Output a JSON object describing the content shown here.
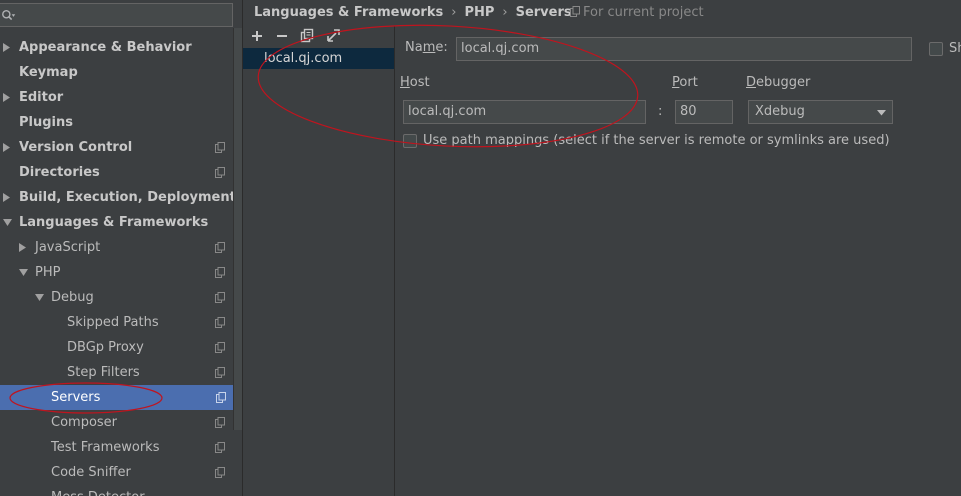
{
  "search": {
    "value": ""
  },
  "tree": {
    "items": [
      {
        "label": "Appearance & Behavior"
      },
      {
        "label": "Keymap"
      },
      {
        "label": "Editor"
      },
      {
        "label": "Plugins"
      },
      {
        "label": "Version Control"
      },
      {
        "label": "Directories"
      },
      {
        "label": "Build, Execution, Deployment"
      },
      {
        "label": "Languages & Frameworks"
      },
      {
        "label": "JavaScript"
      },
      {
        "label": "PHP"
      },
      {
        "label": "Debug"
      },
      {
        "label": "Skipped Paths"
      },
      {
        "label": "DBGp Proxy"
      },
      {
        "label": "Step Filters"
      },
      {
        "label": "Servers"
      },
      {
        "label": "Composer"
      },
      {
        "label": "Test Frameworks"
      },
      {
        "label": "Code Sniffer"
      },
      {
        "label": "Mess Detector"
      }
    ]
  },
  "breadcrumb": {
    "items": [
      "Languages & Frameworks",
      "PHP",
      "Servers"
    ],
    "separator": "›",
    "scope": "For current project"
  },
  "servers": {
    "items": [
      "local.qj.com"
    ]
  },
  "form": {
    "name_label_prefix": "Na",
    "name_label_mnemonic": "m",
    "name_label_suffix": "e:",
    "name_value": "local.qj.com",
    "shared_label": "Sh",
    "host_label_mnemonic": "H",
    "host_label_suffix": "ost",
    "host_value": "local.qj.com",
    "port_label_mnemonic": "P",
    "port_label_suffix": "ort",
    "port_separator": ":",
    "port_value": "80",
    "debugger_label_mnemonic": "D",
    "debugger_label_suffix": "ebugger",
    "debugger_value": "Xdebug",
    "path_mappings_label": "Use path mappings (select if the server is remote or symlinks are used)",
    "path_mappings_checked": false
  },
  "colors": {
    "selection": "#4b6eaf",
    "list_selection": "#0d293e",
    "annotation": "#c0141e"
  }
}
